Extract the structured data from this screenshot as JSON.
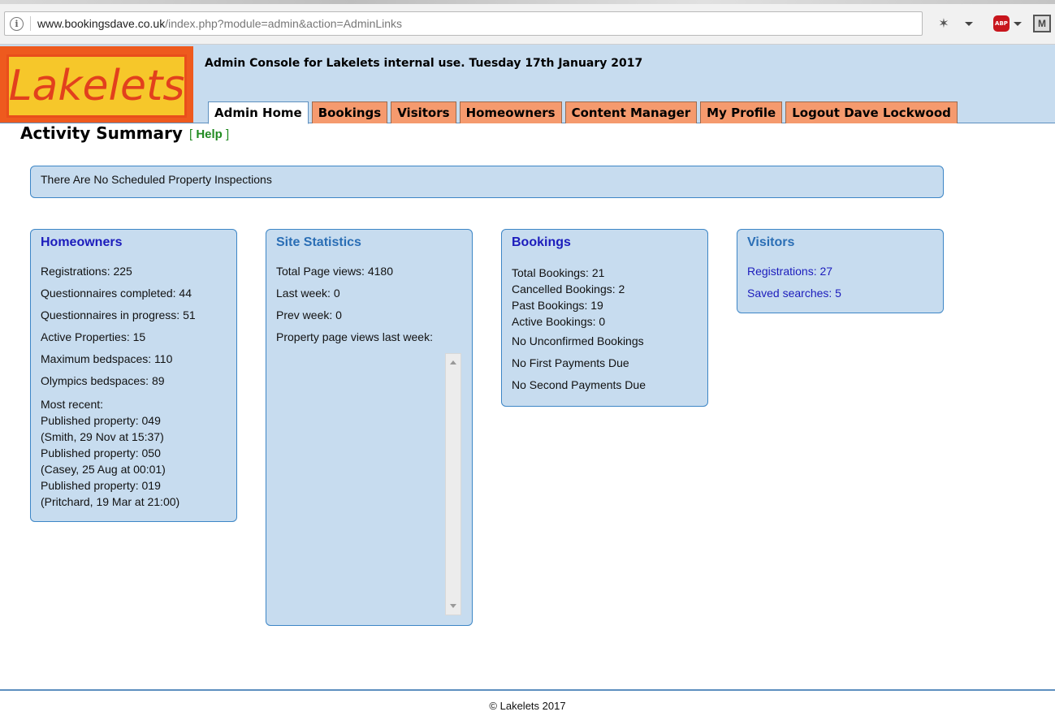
{
  "browser": {
    "url_host": "www.bookingsdave.co.uk",
    "url_path": "/index.php?module=admin&action=AdminLinks",
    "abp_label": "ABP",
    "m_label": "M"
  },
  "header": {
    "logo_text": "Lakelets",
    "title": "Admin Console for Lakelets internal use. Tuesday 17th January 2017",
    "tabs": [
      {
        "label": "Admin Home",
        "active": true
      },
      {
        "label": "Bookings",
        "active": false
      },
      {
        "label": "Visitors",
        "active": false
      },
      {
        "label": "Homeowners",
        "active": false
      },
      {
        "label": "Content Manager",
        "active": false
      },
      {
        "label": "My Profile",
        "active": false
      },
      {
        "label": "Logout Dave Lockwood",
        "active": false
      }
    ]
  },
  "page": {
    "title": "Activity Summary",
    "help_open": "[ ",
    "help_label": "Help",
    "help_close": " ]"
  },
  "inspections": {
    "text": "There Are No Scheduled Property Inspections"
  },
  "homeowners": {
    "heading": "Homeowners",
    "registrations": "Registrations: 225",
    "questionnaires_completed": "Questionnaires completed: 44",
    "questionnaires_in_progress": "Questionnaires in progress: 51",
    "active_properties": "Active Properties: 15",
    "maximum_bedspaces": "Maximum bedspaces: 110",
    "olympics_bedspaces": "Olympics bedspaces: 89",
    "most_recent_label": "Most recent:",
    "recent": [
      {
        "property": "Published property: 049",
        "detail": "(Smith, 29 Nov at 15:37)"
      },
      {
        "property": "Published property: 050",
        "detail": "(Casey, 25 Aug at 00:01)"
      },
      {
        "property": "Published property: 019",
        "detail": "(Pritchard, 19 Mar at 21:00)"
      }
    ]
  },
  "site_statistics": {
    "heading": "Site Statistics",
    "total_page_views": "Total Page views: 4180",
    "last_week": "Last week: 0",
    "prev_week": "Prev week: 0",
    "property_page_views_label": "Property page views last week:"
  },
  "bookings": {
    "heading": "Bookings",
    "total": "Total Bookings: 21",
    "cancelled": "Cancelled Bookings: 2",
    "past": "Past Bookings: 19",
    "active": "Active Bookings: 0",
    "unconfirmed": "No Unconfirmed Bookings",
    "first_payments": "No First Payments Due",
    "second_payments": "No Second Payments Due"
  },
  "visitors": {
    "heading": "Visitors",
    "registrations": "Registrations: 27",
    "saved_searches": "Saved searches: 5"
  },
  "footer": {
    "text": "© Lakelets 2017"
  },
  "colors": {
    "panel_bg": "#c7dcef",
    "panel_border": "#3d86c6",
    "tab_bg": "#f59a6e",
    "help_green": "#228b22",
    "link_blue": "#1c1cbc"
  }
}
